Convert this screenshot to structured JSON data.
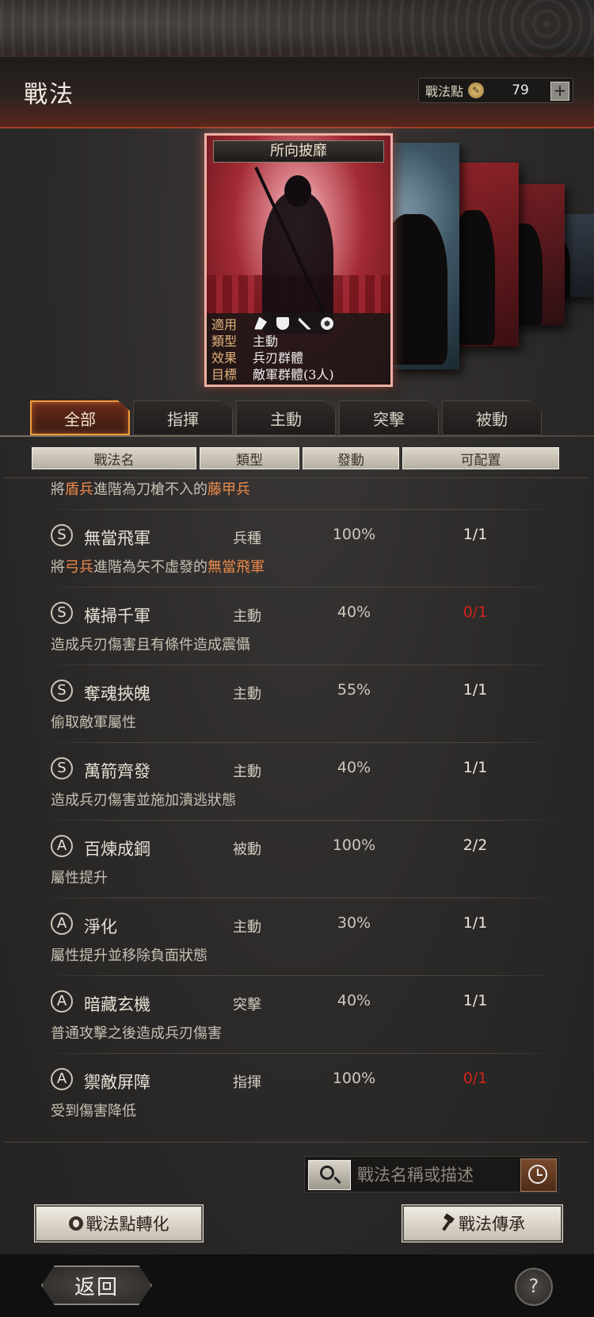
{
  "header": {
    "title": "戰法",
    "points_label": "戰法點",
    "points_value": "79",
    "plus": "+"
  },
  "featured_card": {
    "title": "所向披靡",
    "rows": [
      {
        "key": "適用",
        "value": ""
      },
      {
        "key": "類型",
        "value": "主動"
      },
      {
        "key": "效果",
        "value": "兵刃群體"
      },
      {
        "key": "目標",
        "value": "敵軍群體(3人)"
      }
    ],
    "icons": [
      "cavalry-icon",
      "shield-icon",
      "bow-icon",
      "chariot-wheel-icon"
    ]
  },
  "tabs": [
    "全部",
    "指揮",
    "主動",
    "突擊",
    "被動"
  ],
  "active_tab": 0,
  "columns": [
    "戰法名",
    "類型",
    "發動",
    "可配置"
  ],
  "partial_top_desc": [
    "將",
    "盾兵",
    "進階為刀槍不入的",
    "藤甲兵"
  ],
  "skills": [
    {
      "grade": "S",
      "name": "無當飛軍",
      "type": "兵種",
      "rate": "100%",
      "slots": "1/1",
      "slots_red": false,
      "desc": [
        "將",
        "弓兵",
        "進階為矢不虛發的",
        "無當飛軍"
      ]
    },
    {
      "grade": "S",
      "name": "橫掃千軍",
      "type": "主動",
      "rate": "40%",
      "slots": "0/1",
      "slots_red": true,
      "desc": [
        "造成兵刃傷害且有條件造成震懾"
      ]
    },
    {
      "grade": "S",
      "name": "奪魂挾魄",
      "type": "主動",
      "rate": "55%",
      "slots": "1/1",
      "slots_red": false,
      "desc": [
        "偷取敵軍屬性"
      ]
    },
    {
      "grade": "S",
      "name": "萬箭齊發",
      "type": "主動",
      "rate": "40%",
      "slots": "1/1",
      "slots_red": false,
      "desc": [
        "造成兵刃傷害並施加潰逃狀態"
      ]
    },
    {
      "grade": "A",
      "name": "百煉成鋼",
      "type": "被動",
      "rate": "100%",
      "slots": "2/2",
      "slots_red": false,
      "desc": [
        "屬性提升"
      ]
    },
    {
      "grade": "A",
      "name": "淨化",
      "type": "主動",
      "rate": "30%",
      "slots": "1/1",
      "slots_red": false,
      "desc": [
        "屬性提升並移除負面狀態"
      ]
    },
    {
      "grade": "A",
      "name": "暗藏玄機",
      "type": "突擊",
      "rate": "40%",
      "slots": "1/1",
      "slots_red": false,
      "desc": [
        "普通攻擊之後造成兵刃傷害"
      ]
    },
    {
      "grade": "A",
      "name": "禦敵屏障",
      "type": "指揮",
      "rate": "100%",
      "slots": "0/1",
      "slots_red": true,
      "desc": [
        "受到傷害降低"
      ]
    }
  ],
  "search": {
    "placeholder": "戰法名稱或描述"
  },
  "buttons": {
    "convert": "戰法點轉化",
    "inherit": "戰法傳承"
  },
  "footer": {
    "back": "返回",
    "help": "?"
  },
  "colors": {
    "accent": "#f29a3c",
    "highlight": "#ee8a4b",
    "warning": "#d0221a"
  }
}
